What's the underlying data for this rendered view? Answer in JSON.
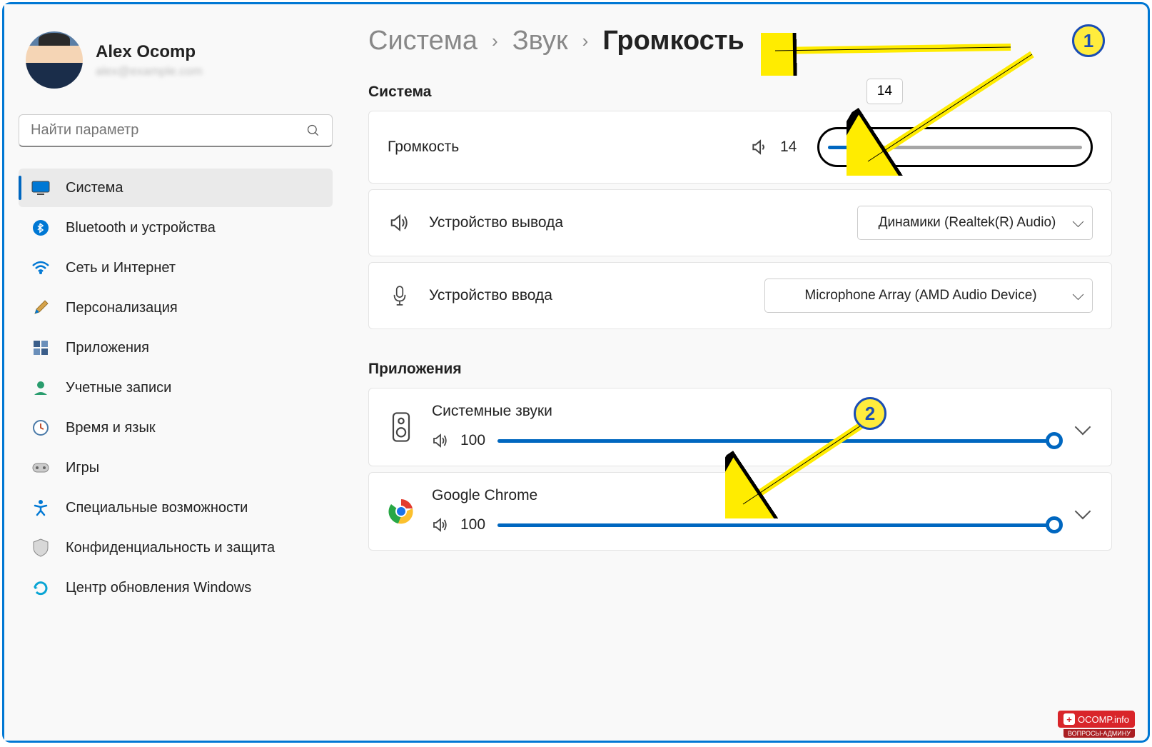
{
  "profile": {
    "name": "Alex Ocomp",
    "email": "alex@example.com"
  },
  "search": {
    "placeholder": "Найти параметр"
  },
  "nav": [
    {
      "label": "Система",
      "icon": "monitor",
      "active": true
    },
    {
      "label": "Bluetooth и устройства",
      "icon": "bluetooth"
    },
    {
      "label": "Сеть и Интернет",
      "icon": "wifi"
    },
    {
      "label": "Персонализация",
      "icon": "brush"
    },
    {
      "label": "Приложения",
      "icon": "apps"
    },
    {
      "label": "Учетные записи",
      "icon": "person"
    },
    {
      "label": "Время и язык",
      "icon": "clock"
    },
    {
      "label": "Игры",
      "icon": "gamepad"
    },
    {
      "label": "Специальные возможности",
      "icon": "accessibility"
    },
    {
      "label": "Конфиденциальность и защита",
      "icon": "shield"
    },
    {
      "label": "Центр обновления Windows",
      "icon": "update"
    }
  ],
  "breadcrumb": {
    "a": "Система",
    "b": "Звук",
    "c": "Громкость"
  },
  "sections": {
    "system": "Система",
    "apps": "Приложения"
  },
  "system": {
    "volume_label": "Громкость",
    "volume_value": "14",
    "volume_tooltip": "14",
    "output_label": "Устройство вывода",
    "output_device": "Динамики (Realtek(R) Audio)",
    "input_label": "Устройство ввода",
    "input_device": "Microphone Array (AMD Audio Device)"
  },
  "apps": [
    {
      "name": "Системные звуки",
      "volume": "100",
      "icon": "speaker-device"
    },
    {
      "name": "Google Chrome",
      "volume": "100",
      "icon": "chrome"
    }
  ],
  "annotations": {
    "b1": "1",
    "b2": "2"
  },
  "watermark": {
    "text": "OCOMP.info",
    "sub": "ВОПРОСЫ-АДМИНУ"
  }
}
